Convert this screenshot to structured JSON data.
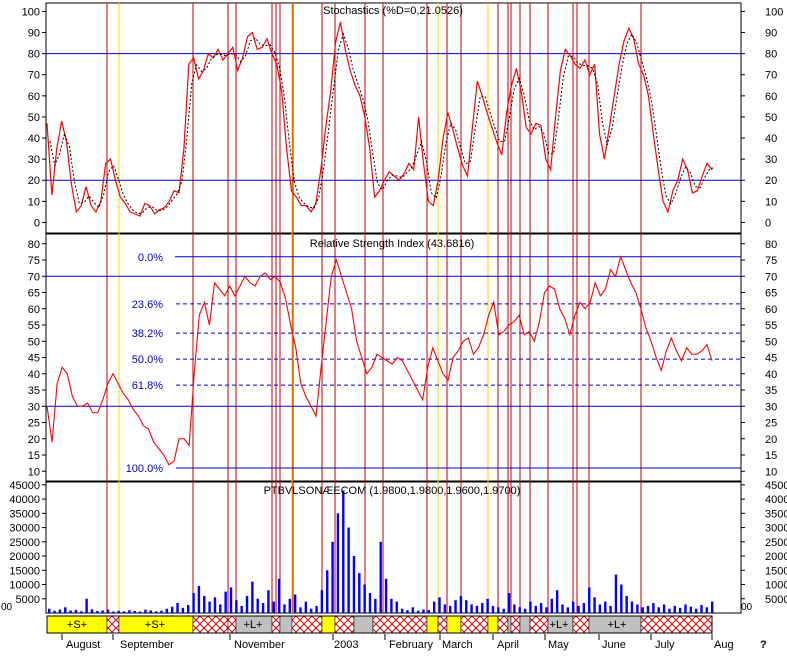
{
  "panels": {
    "stoch": {
      "title": "Stochastics (%D=0,21.0526)",
      "ticks": [
        0,
        10,
        20,
        30,
        40,
        50,
        60,
        70,
        80,
        90,
        100
      ],
      "ylim": [
        -5,
        104
      ],
      "hlines": [
        20,
        80
      ]
    },
    "rsi": {
      "title": "Relative Strength Index (43.6816)",
      "ticks": [
        10,
        15,
        20,
        25,
        30,
        35,
        40,
        45,
        50,
        55,
        60,
        65,
        70,
        75,
        80
      ],
      "ylim": [
        7,
        83
      ],
      "hlines": [
        30,
        70
      ],
      "fib_levels": [
        {
          "label": "0.0%",
          "value": 76
        },
        {
          "label": "23.6%",
          "value": 61.5
        },
        {
          "label": "38.2%",
          "value": 52.5
        },
        {
          "label": "50.0%",
          "value": 44.5
        },
        {
          "label": "61.8%",
          "value": 36.5
        },
        {
          "label": "100.0%",
          "value": 11
        }
      ]
    },
    "volume": {
      "title": "PTBVLSONÆECOM (1.9800,1.9800,1.9600,1.9700)",
      "ticks": [
        5000,
        10000,
        15000,
        20000,
        25000,
        30000,
        35000,
        40000,
        45000
      ],
      "ylim": [
        0,
        46000
      ],
      "left_marker": "00",
      "right_marker": "00"
    }
  },
  "months": [
    "August",
    "September",
    "November",
    "2003",
    "February",
    "March",
    "April",
    "May",
    "June",
    "July",
    "Aug"
  ],
  "corner_glyph": "?",
  "signals": [
    {
      "label": "+S+",
      "color": "yellow"
    },
    {
      "label": "+S+",
      "color": "yellow"
    },
    {
      "label": "+L+",
      "color": "gray"
    },
    {
      "label": "+L+",
      "color": "gray"
    },
    {
      "label": "+L+",
      "color": "gray"
    }
  ],
  "colors": {
    "stoch_line": "#ff0000",
    "stoch_dotted": "#000000",
    "rsi_line": "#ff0000",
    "volume_bar": "#0000ff",
    "guide": "#0000cd",
    "sell_vline": "#cc0000",
    "buy_vline": "#ffd400",
    "signal_yellow": "#ffff00",
    "signal_gray": "#c0c0c0",
    "signal_hatch": "#ff0000"
  },
  "chart_data": [
    {
      "type": "line",
      "title": "Stochastics (%D=0,21.0526)",
      "ylim": [
        0,
        100
      ],
      "series": [
        {
          "values": [
            47,
            13,
            35,
            48,
            38,
            18,
            5,
            8,
            17,
            8,
            5,
            10,
            28,
            30,
            20,
            12,
            9,
            5,
            4,
            3,
            9,
            8,
            4,
            6,
            7,
            10,
            15,
            14,
            35,
            75,
            78,
            68,
            72,
            80,
            78,
            82,
            77,
            80,
            83,
            72,
            78,
            88,
            90,
            82,
            83,
            87,
            80,
            75,
            62,
            35,
            15,
            12,
            8,
            8,
            5,
            9,
            25,
            45,
            62,
            85,
            95,
            82,
            72,
            65,
            60,
            50,
            35,
            12,
            15,
            20,
            24,
            22,
            20,
            23,
            28,
            25,
            50,
            28,
            10,
            8,
            20,
            40,
            52,
            44,
            35,
            27,
            22,
            45,
            67,
            60,
            52,
            45,
            38,
            32,
            52,
            65,
            73,
            62,
            45,
            42,
            47,
            46,
            30,
            25,
            50,
            72,
            82,
            79,
            75,
            73,
            77,
            70,
            75,
            42,
            30,
            45,
            60,
            75,
            86,
            92,
            87,
            75,
            70,
            60,
            42,
            25,
            10,
            5,
            15,
            20,
            30,
            25,
            14,
            15,
            22,
            28,
            25
          ]
        }
      ]
    },
    {
      "type": "line",
      "title": "Relative Strength Index (43.6816)",
      "ylim": [
        10,
        80
      ],
      "series": [
        {
          "values": [
            30,
            19,
            37,
            42,
            40,
            33,
            30,
            30,
            31,
            28,
            28,
            32,
            37,
            40,
            37,
            34,
            32,
            29,
            27,
            24,
            23,
            19,
            17,
            15,
            12,
            13,
            20,
            20,
            18,
            40,
            58,
            62,
            55,
            68,
            66,
            64,
            67,
            64,
            67,
            70,
            68,
            67,
            70,
            71,
            69,
            70,
            68,
            63,
            55,
            48,
            37,
            33,
            30,
            27,
            42,
            56,
            70,
            75,
            70,
            65,
            60,
            50,
            45,
            40,
            42,
            46,
            45,
            44,
            43,
            45,
            44,
            41,
            38,
            35,
            32,
            42,
            48,
            44,
            40,
            38,
            45,
            47,
            50,
            51,
            46,
            48,
            52,
            58,
            62,
            52,
            53,
            55,
            56,
            58,
            52,
            53,
            50,
            56,
            65,
            67,
            66,
            60,
            57,
            52,
            58,
            62,
            60,
            62,
            68,
            64,
            66,
            72,
            70,
            76,
            72,
            68,
            65,
            60,
            54,
            50,
            45,
            41,
            47,
            51,
            47,
            44,
            48,
            46,
            46,
            47,
            49,
            44
          ]
        }
      ]
    },
    {
      "type": "bar",
      "title": "PTBVLSONÆECOM (1.9800,1.9800,1.9600,1.9700)",
      "ylim": [
        0,
        45000
      ],
      "series": [
        {
          "values": [
            1500,
            800,
            1200,
            2000,
            900,
            1100,
            600,
            5000,
            1300,
            700,
            900,
            1200,
            500,
            800,
            600,
            1000,
            700,
            500,
            1200,
            900,
            600,
            800,
            1500,
            2200,
            3500,
            1800,
            2800,
            7000,
            9500,
            6000,
            4000,
            5500,
            3000,
            7500,
            9000,
            4500,
            2500,
            6000,
            11000,
            5000,
            3500,
            8000,
            4000,
            12000,
            3000,
            5000,
            6500,
            2000,
            4000,
            1500,
            2500,
            8000,
            15000,
            25000,
            35000,
            43000,
            30000,
            20000,
            14000,
            10000,
            7000,
            5000,
            25000,
            12000,
            5000,
            4000,
            1500,
            1000,
            2000,
            800,
            1200,
            1000,
            4000,
            5500,
            3000,
            2500,
            4500,
            6000,
            4500,
            3000,
            2500,
            3500,
            5000,
            2500,
            2000,
            1500,
            7000,
            3000,
            2000,
            1500,
            4000,
            2500,
            3500,
            2000,
            5000,
            8000,
            3000,
            2000,
            4000,
            2500,
            3500,
            9000,
            5500,
            3000,
            4000,
            2500,
            13500,
            10000,
            6000,
            4000,
            3000,
            2000,
            2500,
            3500,
            2000,
            3000,
            1500,
            2500,
            1800,
            3000,
            2200,
            1500,
            2800,
            2000,
            4000
          ]
        }
      ]
    }
  ]
}
